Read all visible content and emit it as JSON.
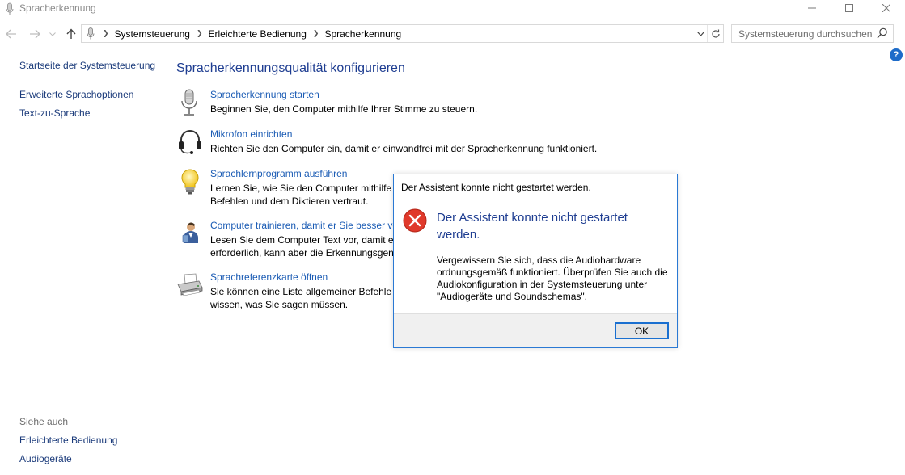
{
  "window": {
    "title": "Spracherkennung",
    "controls": {
      "minimize": "—",
      "maximize": "☐",
      "close": "✕"
    }
  },
  "address": {
    "breadcrumb": [
      "Systemsteuerung",
      "Erleichterte Bedienung",
      "Spracherkennung"
    ],
    "search_placeholder": "Systemsteuerung durchsuchen"
  },
  "help_label": "?",
  "left_pane": {
    "home_link": "Startseite der Systemsteuerung",
    "links": [
      "Erweiterte Sprachoptionen",
      "Text-zu-Sprache"
    ],
    "see_also_label": "Siehe auch",
    "see_also_links": [
      "Erleichterte Bedienung",
      "Audiogeräte"
    ]
  },
  "main": {
    "heading": "Spracherkennungsqualität konfigurieren",
    "tasks": [
      {
        "icon": "microphone-icon",
        "link": "Spracherkennung starten",
        "desc": "Beginnen Sie, den Computer mithilfe Ihrer Stimme zu steuern."
      },
      {
        "icon": "headset-icon",
        "link": "Mikrofon einrichten",
        "desc": "Richten Sie den Computer ein, damit er einwandfrei mit der Spracherkennung funktioniert."
      },
      {
        "icon": "lightbulb-icon",
        "link": "Sprachlernprogramm ausführen",
        "desc_line1": "Lernen Sie, wie Sie den Computer mithilfe d",
        "desc_line2": "Befehlen und dem Diktieren vertraut."
      },
      {
        "icon": "user-train-icon",
        "link": "Computer trainieren, damit er Sie besser ve",
        "desc_line1": "Lesen Sie dem Computer Text vor, damit er",
        "desc_line2": "erforderlich, kann aber die Erkennungsgena"
      },
      {
        "icon": "printer-icon",
        "link": "Sprachreferenzkarte öffnen",
        "desc_line1": "Sie können eine Liste allgemeiner Befehle a",
        "desc_line2": "wissen, was Sie sagen müssen."
      }
    ]
  },
  "dialog": {
    "title": "Der Assistent konnte nicht gestartet werden.",
    "heading": "Der Assistent konnte nicht gestartet werden.",
    "body": "Vergewissern Sie sich, dass die Audiohardware ordnungsgemäß funktioniert. Überprüfen Sie auch die Audiokonfiguration in der Systemsteuerung unter \"Audiogeräte und Soundschemas\".",
    "ok_label": "OK"
  },
  "colors": {
    "link": "#1a5bb4",
    "heading": "#1e3d91",
    "dialog_border": "#2a79d4",
    "error_red": "#e0392b"
  }
}
